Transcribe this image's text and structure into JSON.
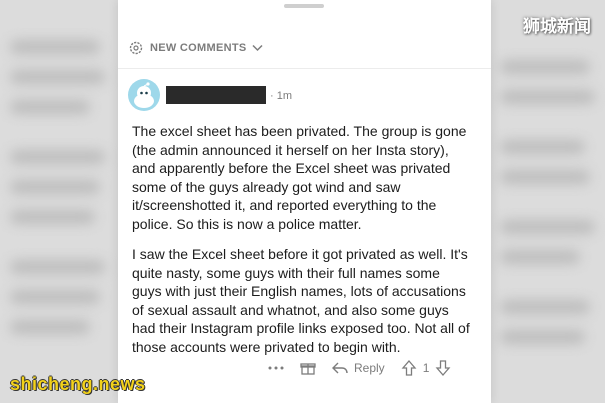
{
  "header": {
    "sort_label": "NEW COMMENTS"
  },
  "comment": {
    "time": "· 1m",
    "paragraphs": [
      "The excel sheet has been privated. The group is gone (the admin announced it herself on her Insta story), and apparently before the Excel sheet was privated some of the guys already got wind and saw it/screenshotted it, and reported everything to the police. So this is now a police matter.",
      "I saw the Excel sheet before it got privated as well. It's quite nasty, some guys with their full names some guys with just their English names, lots of accusations of sexual assault and whatnot, and also some guys had their Instagram profile links exposed too. Not all of those accounts were privated to begin with."
    ]
  },
  "actions": {
    "reply_label": "Reply",
    "vote_count": "1"
  },
  "watermarks": {
    "top": "狮城新闻",
    "bottom": "shicheng.news"
  },
  "icons": [
    "more-dots-icon",
    "award-icon",
    "reply-arrow-icon",
    "upvote-icon",
    "downvote-icon",
    "sort-gear-icon",
    "chevron-down-icon"
  ]
}
